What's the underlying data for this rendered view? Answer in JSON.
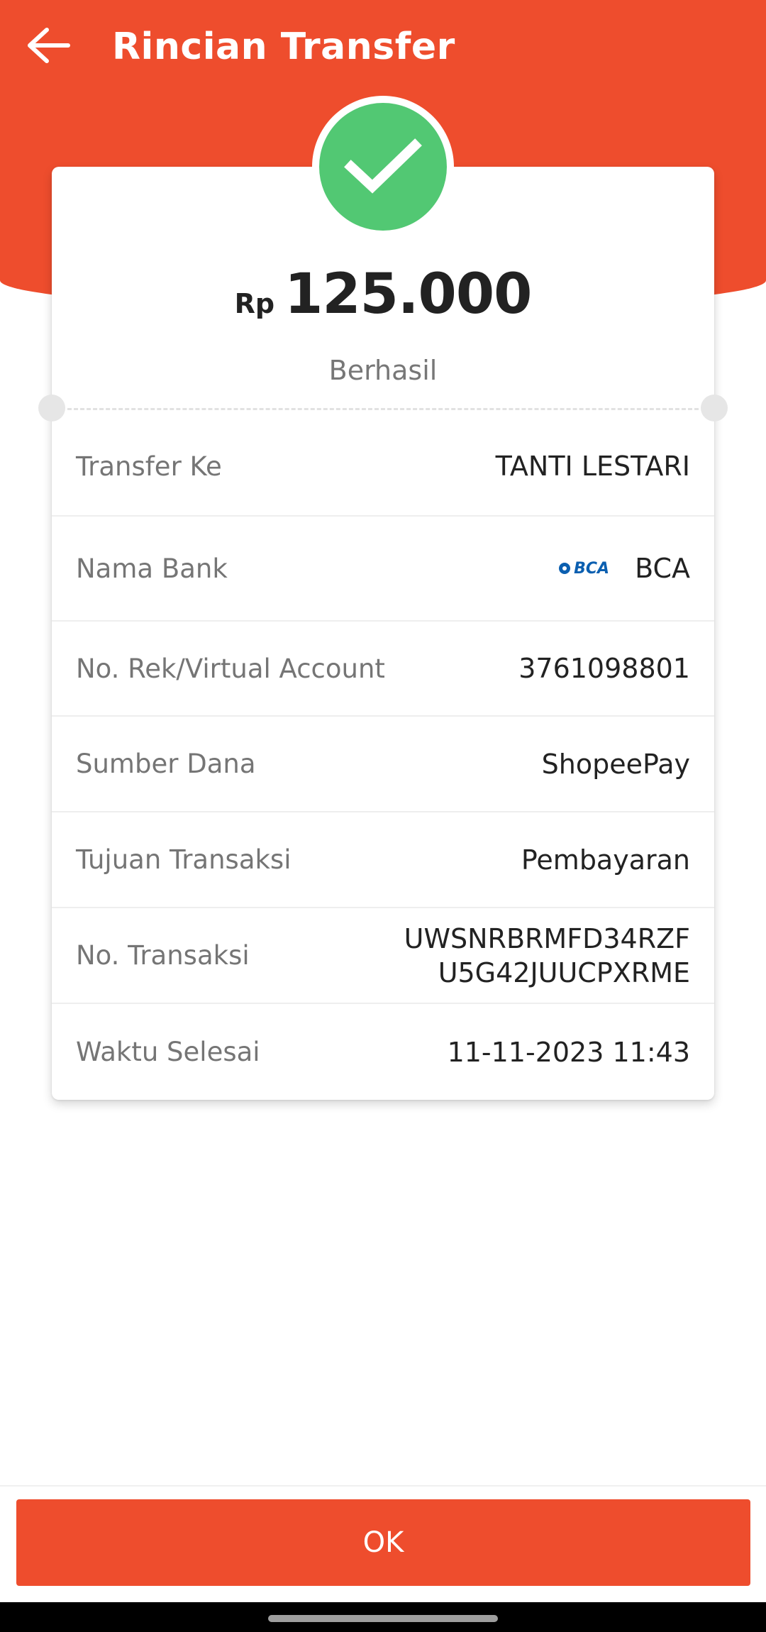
{
  "header": {
    "title": "Rincian Transfer",
    "back_icon": "arrow-left-icon",
    "background_color": "#EE4D2D"
  },
  "summary": {
    "status_icon": "check-circle-icon",
    "currency": "Rp",
    "amount": "125.000",
    "status": "Berhasil",
    "success_color": "#52C873"
  },
  "details": [
    {
      "label": "Transfer Ke",
      "value": "TANTI LESTARI"
    },
    {
      "label": "Nama Bank",
      "value": "BCA",
      "logo_text": "BCA"
    },
    {
      "label": "No. Rek/Virtual Account",
      "value": "3761098801"
    },
    {
      "label": "Sumber Dana",
      "value": "ShopeePay"
    },
    {
      "label": "Tujuan Transaksi",
      "value": "Pembayaran"
    },
    {
      "label": "No. Transaksi",
      "value_line1": "UWSNRBRMFD34RZF",
      "value_line2": "U5G42JUUCPXRME"
    },
    {
      "label": "Waktu Selesai",
      "value": "11-11-2023 11:43"
    }
  ],
  "footer": {
    "ok_label": "OK"
  }
}
